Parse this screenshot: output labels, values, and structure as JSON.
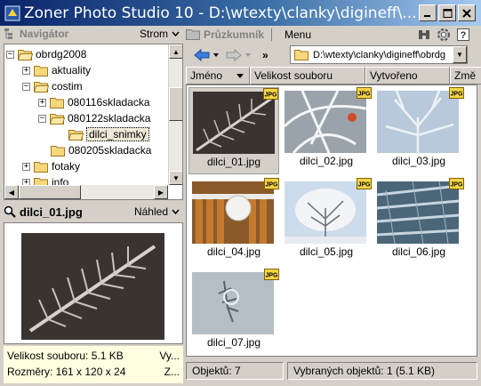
{
  "window": {
    "title": "Zoner Photo Studio 10 - D:\\wtexty\\clanky\\digineff\\...",
    "min_icon": "minimize-icon",
    "max_icon": "maximize-icon",
    "close_icon": "close-icon"
  },
  "navigator": {
    "title": "Navigátor",
    "menu_label": "Strom",
    "tree": [
      {
        "label": "obrdg2008",
        "level": 0,
        "toggle": "-"
      },
      {
        "label": "aktuality",
        "level": 1,
        "toggle": "+"
      },
      {
        "label": "costim",
        "level": 1,
        "toggle": "-"
      },
      {
        "label": "080116skladacka",
        "level": 2,
        "toggle": "+"
      },
      {
        "label": "080122skladacka",
        "level": 2,
        "toggle": "-"
      },
      {
        "label": "dilci_snimky",
        "level": 3,
        "toggle": "",
        "selected": true
      },
      {
        "label": "080205skladacka",
        "level": 2,
        "toggle": ""
      },
      {
        "label": "fotaky",
        "level": 1,
        "toggle": "+"
      },
      {
        "label": "info",
        "level": 1,
        "toggle": "+"
      }
    ]
  },
  "preview": {
    "filename": "dilci_01.jpg",
    "menu_label": "Náhled",
    "info_size_label": "Velikost souboru: 5.1 KB",
    "info_size_extra": "Vy...",
    "info_dims_label": "Rozměry: 161 x 120 x 24",
    "info_dims_extra": "Z..."
  },
  "explorer": {
    "title": "Průzkumník",
    "menu_label": "Menu",
    "address": "D:\\wtexty\\clanky\\digineff\\obrdg",
    "columns": [
      "Jméno",
      "Velikost souboru",
      "Vytvořeno",
      "Změ"
    ],
    "badge_text": "JPG",
    "items": [
      {
        "name": "dilci_01.jpg",
        "selected": true
      },
      {
        "name": "dilci_02.jpg"
      },
      {
        "name": "dilci_03.jpg"
      },
      {
        "name": "dilci_04.jpg"
      },
      {
        "name": "dilci_05.jpg"
      },
      {
        "name": "dilci_06.jpg"
      },
      {
        "name": "dilci_07.jpg"
      }
    ]
  },
  "status": {
    "objects": "Objektů: 7",
    "selected": "Vybraných objektů: 1 (5.1 KB)"
  },
  "colors": {
    "title_start": "#0a246a",
    "title_end": "#a6caf0",
    "face": "#d4d0c8",
    "info_bg": "#ffffe1",
    "folder": "#f6d87a"
  }
}
